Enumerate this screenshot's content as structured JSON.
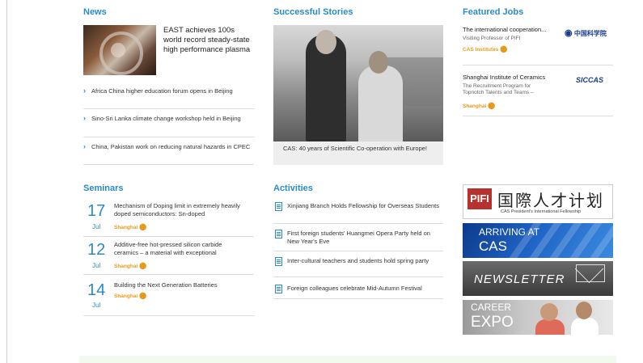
{
  "news": {
    "title": "News",
    "headline": "EAST achieves 100s world record steady-state high performance plasma",
    "items": [
      "Africa China higher education forum opens in Beijing",
      "Sino-Sri Lanka climate change workshop held in Beijing",
      "China, Pakistan work on reducing natural hazards in CPEC"
    ]
  },
  "stories": {
    "title": "Successful Stories",
    "caption": "CAS: 40 years of Scientific Co-operation with Europe!"
  },
  "jobs": {
    "title": "Featured Jobs",
    "items": [
      {
        "title": "The international cooperation...",
        "sub": "Visiting Professor of PIFI",
        "location": "CAS Institutes",
        "logo": "中国科学院"
      },
      {
        "title": "Shanghai Institute of Ceramics",
        "sub": "The Recruitment Program for Topnotch Talents and Teams –",
        "location": "Shanghai",
        "logo": "SICCAS"
      }
    ]
  },
  "seminars": {
    "title": "Seminars",
    "items": [
      {
        "day": "17",
        "month": "Jul",
        "title": "Mechanism of Doping limit in extremely heavily doped semiconductors: Sn-doped",
        "location": "Shanghai"
      },
      {
        "day": "12",
        "month": "Jul",
        "title": "Additive-free hot-pressed silicon carbide ceramics – a material with exceptional",
        "location": "Shanghai"
      },
      {
        "day": "14",
        "month": "Jul",
        "title": "Building the Next Generation Batteries",
        "location": "Shanghai"
      }
    ]
  },
  "activities": {
    "title": "Activities",
    "items": [
      "Xinjiang Branch Holds Fellowship for Overseas Students",
      "First foreign students' Huangmei Opera Party held on New Year's Eve",
      "Inter-cultural teachers and students hold spring party",
      "Foreign colleagues celebrate Mid-Autumn Festival"
    ]
  },
  "banners": {
    "pifi_logo": "PIFI",
    "pifi_cn": "国際人才计划",
    "pifi_sub": "CAS President's International Fellowship",
    "arriving_line1": "ARRIVING AT",
    "arriving_line2": "CAS",
    "newsletter": "NEWSLETTER",
    "career_line1": "CAREER",
    "career_line2": "EXPO"
  }
}
